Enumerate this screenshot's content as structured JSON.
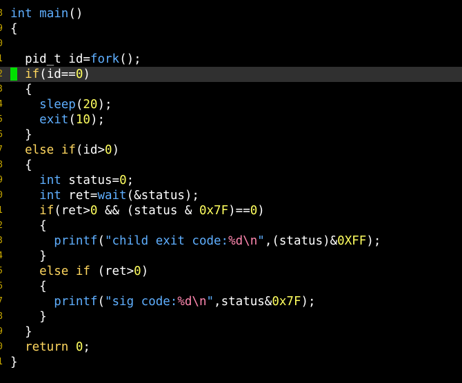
{
  "editor": {
    "cursor_line": 4,
    "colors": {
      "background": "#000000",
      "text": "#ffffff",
      "type": "#5fafff",
      "function": "#5fafff",
      "keyword": "#ffd75f",
      "number": "#ffff5f",
      "string": "#5fafff",
      "format": "#ff87af",
      "line_numbers": "#c8a800",
      "cursor": "#00e000",
      "cursorline": "#303030"
    },
    "lines": [
      {
        "gutter": "8",
        "tokens": [
          [
            "type",
            "int"
          ],
          [
            "plain",
            " "
          ],
          [
            "func",
            "main"
          ],
          [
            "plain",
            "()"
          ]
        ]
      },
      {
        "gutter": "9",
        "tokens": [
          [
            "plain",
            "{"
          ]
        ]
      },
      {
        "gutter": "0",
        "tokens": []
      },
      {
        "gutter": "1",
        "tokens": [
          [
            "plain",
            "  pid_t id="
          ],
          [
            "func",
            "fork"
          ],
          [
            "plain",
            "();"
          ]
        ]
      },
      {
        "gutter": "2",
        "tokens": [
          [
            "plain",
            "  "
          ],
          [
            "keyword",
            "if"
          ],
          [
            "plain",
            "(id=="
          ],
          [
            "number",
            "0"
          ],
          [
            "plain",
            ")"
          ]
        ]
      },
      {
        "gutter": "3",
        "tokens": [
          [
            "plain",
            "  {"
          ]
        ]
      },
      {
        "gutter": "4",
        "tokens": [
          [
            "plain",
            "    "
          ],
          [
            "func",
            "sleep"
          ],
          [
            "plain",
            "("
          ],
          [
            "number",
            "20"
          ],
          [
            "plain",
            ");"
          ]
        ]
      },
      {
        "gutter": "5",
        "tokens": [
          [
            "plain",
            "    "
          ],
          [
            "func",
            "exit"
          ],
          [
            "plain",
            "("
          ],
          [
            "number",
            "10"
          ],
          [
            "plain",
            ");"
          ]
        ]
      },
      {
        "gutter": "6",
        "tokens": [
          [
            "plain",
            "  }"
          ]
        ]
      },
      {
        "gutter": "7",
        "tokens": [
          [
            "plain",
            "  "
          ],
          [
            "keyword",
            "else"
          ],
          [
            "plain",
            " "
          ],
          [
            "keyword",
            "if"
          ],
          [
            "plain",
            "(id>"
          ],
          [
            "number",
            "0"
          ],
          [
            "plain",
            ")"
          ]
        ]
      },
      {
        "gutter": "8",
        "tokens": [
          [
            "plain",
            "  {"
          ]
        ]
      },
      {
        "gutter": "9",
        "tokens": [
          [
            "plain",
            "    "
          ],
          [
            "type",
            "int"
          ],
          [
            "plain",
            " status="
          ],
          [
            "number",
            "0"
          ],
          [
            "plain",
            ";"
          ]
        ]
      },
      {
        "gutter": "0",
        "tokens": [
          [
            "plain",
            "    "
          ],
          [
            "type",
            "int"
          ],
          [
            "plain",
            " ret="
          ],
          [
            "func",
            "wait"
          ],
          [
            "plain",
            "(&status);"
          ]
        ]
      },
      {
        "gutter": "1",
        "tokens": [
          [
            "plain",
            "    "
          ],
          [
            "keyword",
            "if"
          ],
          [
            "plain",
            "(ret>"
          ],
          [
            "number",
            "0"
          ],
          [
            "plain",
            " && (status & "
          ],
          [
            "number",
            "0x7F"
          ],
          [
            "plain",
            ")=="
          ],
          [
            "number",
            "0"
          ],
          [
            "plain",
            ")"
          ]
        ]
      },
      {
        "gutter": "2",
        "tokens": [
          [
            "plain",
            "    {"
          ]
        ]
      },
      {
        "gutter": "3",
        "tokens": [
          [
            "plain",
            "      "
          ],
          [
            "func",
            "printf"
          ],
          [
            "plain",
            "("
          ],
          [
            "string",
            "\"child exit code:"
          ],
          [
            "format",
            "%d\\n"
          ],
          [
            "string",
            "\""
          ],
          [
            "plain",
            ",(status)&"
          ],
          [
            "number",
            "0XFF"
          ],
          [
            "plain",
            ");"
          ]
        ]
      },
      {
        "gutter": "4",
        "tokens": [
          [
            "plain",
            "    }"
          ]
        ]
      },
      {
        "gutter": "5",
        "tokens": [
          [
            "plain",
            "    "
          ],
          [
            "keyword",
            "else"
          ],
          [
            "plain",
            " "
          ],
          [
            "keyword",
            "if"
          ],
          [
            "plain",
            " (ret>"
          ],
          [
            "number",
            "0"
          ],
          [
            "plain",
            ")"
          ]
        ]
      },
      {
        "gutter": "6",
        "tokens": [
          [
            "plain",
            "    {"
          ]
        ]
      },
      {
        "gutter": "7",
        "tokens": [
          [
            "plain",
            "      "
          ],
          [
            "func",
            "printf"
          ],
          [
            "plain",
            "("
          ],
          [
            "string",
            "\"sig code:"
          ],
          [
            "format",
            "%d\\n"
          ],
          [
            "string",
            "\""
          ],
          [
            "plain",
            ",status&"
          ],
          [
            "number",
            "0x7F"
          ],
          [
            "plain",
            ");"
          ]
        ]
      },
      {
        "gutter": "8",
        "tokens": [
          [
            "plain",
            "    }"
          ]
        ]
      },
      {
        "gutter": "9",
        "tokens": [
          [
            "plain",
            "  }"
          ]
        ]
      },
      {
        "gutter": "0",
        "tokens": [
          [
            "plain",
            "  "
          ],
          [
            "keyword",
            "return"
          ],
          [
            "plain",
            " "
          ],
          [
            "number",
            "0"
          ],
          [
            "plain",
            ";"
          ]
        ]
      },
      {
        "gutter": "1",
        "tokens": [
          [
            "plain",
            "}"
          ]
        ]
      }
    ]
  }
}
